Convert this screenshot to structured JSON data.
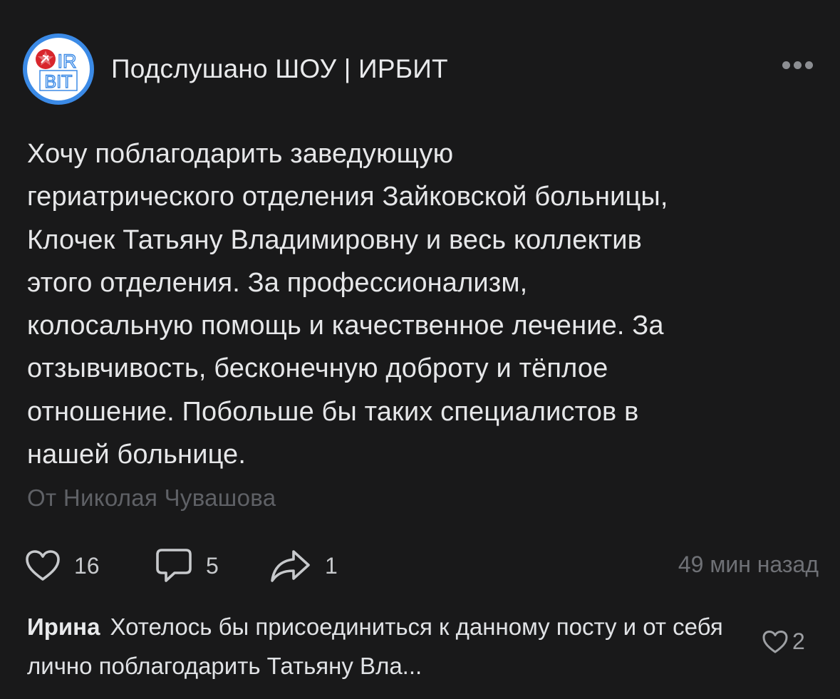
{
  "post": {
    "group_name": "Подслушано ШОУ | ИРБИТ",
    "avatar_text_top": "IR",
    "avatar_text_bottom": "BIT",
    "more_icon": "more-horizontal-icon",
    "text": "Хочу поблагодарить заведующую\nгериатрического отделения Зайковской больницы,\nКлочек Татьяну Владимировну и весь коллектив\nэтого отделения. За профессионализм,\nколосальную помощь и качественное лечение. За\nотзывчивость, бесконечную доброту и тёплое\nотношение. Побольше бы таких специалистов в\nнашей больнице.",
    "signature": "От Николая Чувашова",
    "likes": "16",
    "comments": "5",
    "shares": "1",
    "time": "49 мин назад"
  },
  "comment": {
    "author": "Ирина",
    "text": "Хотелось бы присоединиться к данному посту и от себя лично поблагодарить Татьяну Вла...",
    "likes": "2"
  },
  "colors": {
    "background": "#19191a",
    "text": "#e1e3e6",
    "secondary": "#6f7176",
    "avatar_ring": "#3b8ae6",
    "logo_red": "#d8262c"
  }
}
